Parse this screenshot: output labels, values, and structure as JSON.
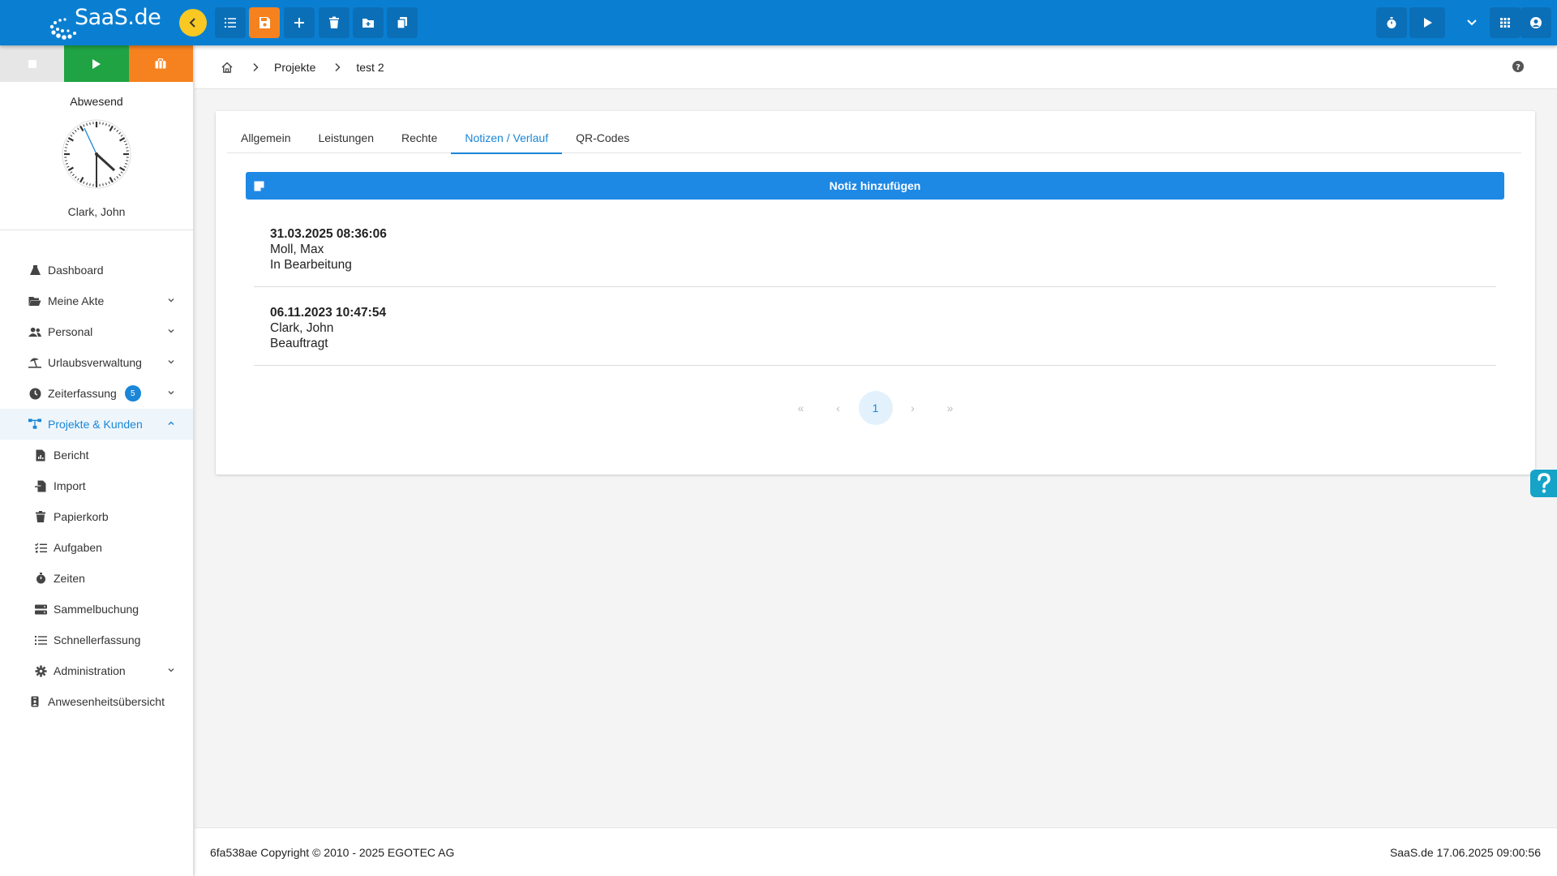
{
  "header": {
    "logo_text": "SaaS.de",
    "buttons": [
      "list-icon",
      "save-icon",
      "plus-icon",
      "trash-icon",
      "folder-plus-icon",
      "copy-icon"
    ],
    "right_buttons": [
      "stopwatch-icon",
      "play-icon",
      "chevron-down-icon",
      "grid-icon",
      "user-icon"
    ]
  },
  "sidebar": {
    "status_label": "Abwesend",
    "user_name": "Clark, John",
    "items": [
      {
        "label": "Dashboard",
        "icon": "dashboard-icon"
      },
      {
        "label": "Meine Akte",
        "icon": "folder-open-icon"
      },
      {
        "label": "Personal",
        "icon": "users-icon"
      },
      {
        "label": "Urlaubsverwaltung",
        "icon": "umbrella-beach-icon"
      },
      {
        "label": "Zeiterfassung",
        "icon": "clock-icon",
        "badge": "5"
      },
      {
        "label": "Projekte & Kunden",
        "icon": "sitemap-icon"
      },
      {
        "label": "Bericht",
        "icon": "file-chart-icon"
      },
      {
        "label": "Import",
        "icon": "file-import-icon"
      },
      {
        "label": "Papierkorb",
        "icon": "trash-icon"
      },
      {
        "label": "Aufgaben",
        "icon": "tasks-icon"
      },
      {
        "label": "Zeiten",
        "icon": "stopwatch-icon"
      },
      {
        "label": "Sammelbuchung",
        "icon": "server-icon"
      },
      {
        "label": "Schnellerfassung",
        "icon": "list-icon"
      },
      {
        "label": "Administration",
        "icon": "gear-icon"
      },
      {
        "label": "Anwesenheitsübersicht",
        "icon": "badge-icon"
      }
    ]
  },
  "breadcrumb": {
    "items": [
      "Projekte",
      "test 2"
    ]
  },
  "tabs": [
    "Allgemein",
    "Leistungen",
    "Rechte",
    "Notizen / Verlauf",
    "QR-Codes"
  ],
  "add_note_label": "Notiz hinzufügen",
  "notes": [
    {
      "date": "31.03.2025 08:36:06",
      "author": "Moll, Max",
      "status": "In Bearbeitung"
    },
    {
      "date": "06.11.2023 10:47:54",
      "author": "Clark, John",
      "status": "Beauftragt"
    }
  ],
  "pagination": {
    "first": "«",
    "prev": "‹",
    "current": "1",
    "next": "›",
    "last": "»"
  },
  "footer": {
    "left": "6fa538ae Copyright © 2010 - 2025 EGOTEC AG",
    "right": "SaaS.de  17.06.2025 09:00:56"
  },
  "colors": {
    "primary": "#0a7fd2",
    "accent": "#1a86d8",
    "save": "#f5821f",
    "play": "#1fa343",
    "collapse": "#f9c823"
  }
}
